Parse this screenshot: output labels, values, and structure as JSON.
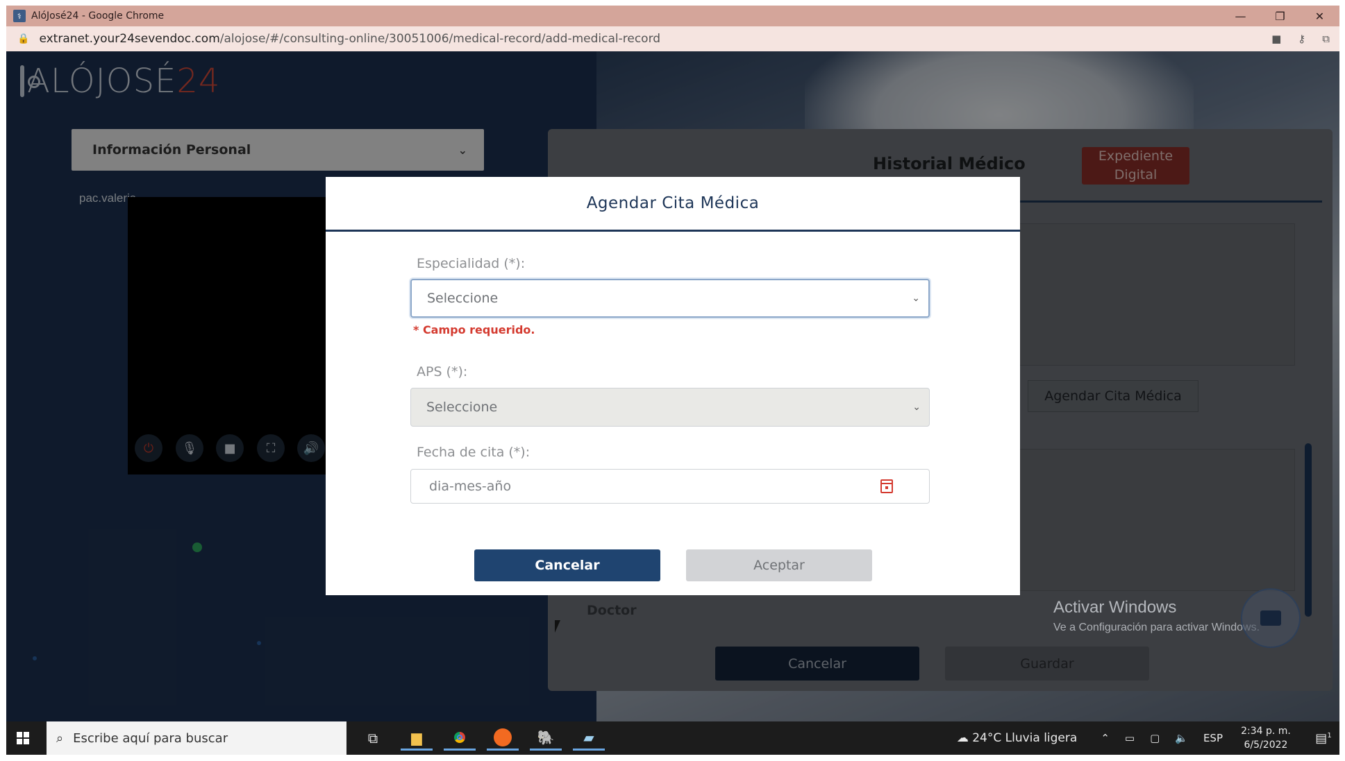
{
  "window": {
    "title": "AlóJosé24 - Google Chrome",
    "controls": [
      "—",
      "❐",
      "✕"
    ]
  },
  "address": {
    "host": "extranet.your24sevendoc.com",
    "path": "/alojose/#/consulting-online/30051006/medical-record/add-medical-record"
  },
  "logo": {
    "part1": "ALÓJOSÉ",
    "part2": "24"
  },
  "left": {
    "panel_title": "Información Personal",
    "patient": "pac.valeria"
  },
  "right": {
    "title": "Historial Médico",
    "expediente_button": "Expediente Digital",
    "agendar_button": "Agendar Cita Médica",
    "doctor_label": "Doctor",
    "cancel_button": "Cancelar",
    "save_button": "Guardar"
  },
  "watermark": {
    "line1": "Activar Windows",
    "line2": "Ve a Configuración para activar Windows."
  },
  "modal": {
    "title": "Agendar Cita Médica",
    "especialidad_label": "Especialidad (*):",
    "especialidad_value": "Seleccione",
    "required_msg": "* Campo requerido.",
    "aps_label": "APS (*):",
    "aps_value": "Seleccione",
    "fecha_label": "Fecha de cita (*):",
    "fecha_placeholder": "dia-mes-año",
    "cancel_button": "Cancelar",
    "accept_button": "Aceptar"
  },
  "taskbar": {
    "search_placeholder": "Escribe aquí para buscar",
    "weather": "24°C  Lluvia ligera",
    "language": "ESP",
    "time": "2:34 p. m.",
    "date": "6/5/2022",
    "notifications": "1"
  },
  "colors": {
    "primary": "#1f4470",
    "danger": "#d43a2f",
    "background": "#1d3150"
  }
}
